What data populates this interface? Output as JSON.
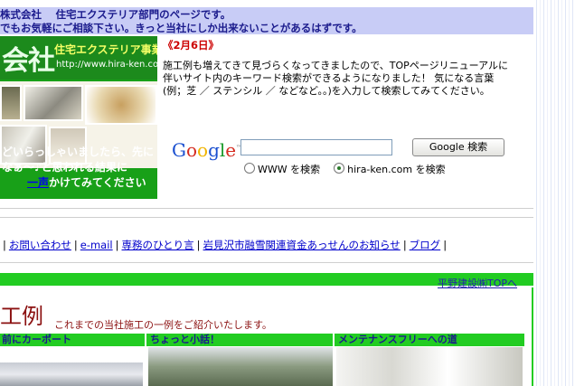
{
  "header": {
    "line1": "株式会社　 住宅エクステリア部門のページです。",
    "line2": "でもお気軽にご相談下さい。きっと当社にしか出来ないことがあるはずです。"
  },
  "banner": {
    "logo_kanji": "会社",
    "logo_sub": "住宅エクステリア事業部",
    "logo_url": "http://www.hira-ken.com",
    "text_line1": "どいらっしゃいましたら、先に",
    "text_line2": "なぁ～♪と思われる結果に",
    "text_line3_pre": "",
    "text_link": "一声",
    "text_line3_post": "かけてみてください"
  },
  "news": {
    "date": "《2月6日》",
    "notice": "施工例も増えてきて見づらくなってきましたので、TOPページリニューアルに伴いサイト内のキーワード検索ができるようになりました！ 気になる言葉(例；芝 ／ ステンシル ／ などなど。。)を入力して検索してみてください。"
  },
  "search": {
    "logo_letters": [
      "G",
      "o",
      "o",
      "g",
      "l",
      "e"
    ],
    "logo_tm": "™",
    "input_value": "",
    "button_label": "Google 検索",
    "radio_www": "WWW を検索",
    "radio_site": "hira-ken.com を検索",
    "selected": "site"
  },
  "nav": {
    "items": [
      "お問い合わせ",
      "e-mail",
      "専務のひとり言",
      "岩見沢市融雪関連資金あっせんのお知らせ",
      "ブログ"
    ]
  },
  "toplink": "平野建設㈱TOPへ",
  "works": {
    "title": "工例",
    "subtitle": "これまでの当社施工の一例をご紹介いたします。",
    "items": [
      "前にカーポート",
      "ちょっと小話！",
      "メンテナンスフリーへの道"
    ]
  },
  "colors": {
    "accent_green": "#22cc22",
    "header_bg": "#c8ccf6",
    "date_red": "#cc0000",
    "title_maroon": "#8b1010"
  }
}
